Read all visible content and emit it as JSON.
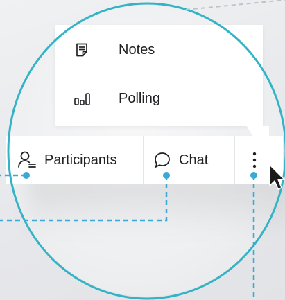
{
  "menu": {
    "items": [
      {
        "label": "Notes",
        "icon": "notes-icon"
      },
      {
        "label": "Polling",
        "icon": "polling-icon"
      }
    ]
  },
  "toolbar": {
    "participants_label": "Participants",
    "chat_label": "Chat",
    "more_icon": "more-vertical-icon"
  },
  "colors": {
    "highlight_circle": "#34b3c6",
    "callout_lines": "#3aa9d6",
    "text": "#202124"
  }
}
